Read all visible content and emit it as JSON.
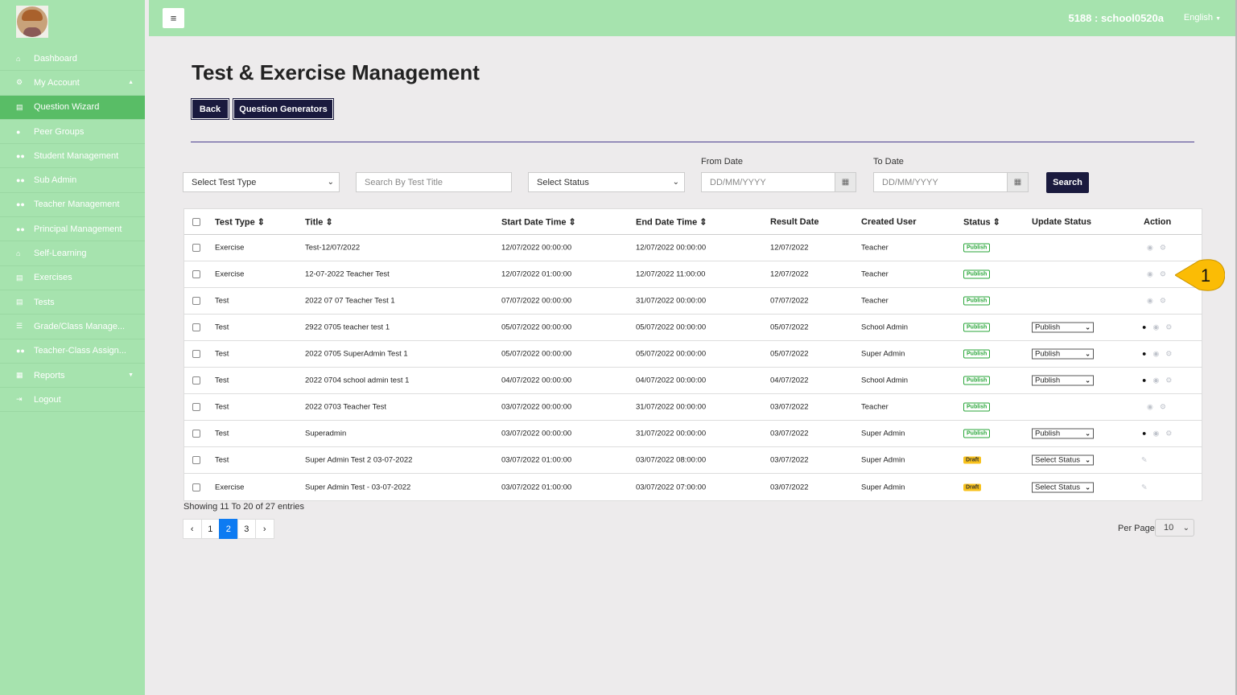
{
  "sidebar": {
    "items": [
      {
        "label": "Dashboard",
        "icon": "home-icon",
        "glyph": "⌂"
      },
      {
        "label": "My Account",
        "icon": "cogs-icon",
        "glyph": "⚙",
        "caret": "▲"
      },
      {
        "label": "Question Wizard",
        "icon": "book-icon",
        "glyph": "▤",
        "active": true
      },
      {
        "label": "Peer Groups",
        "icon": "user-icon",
        "glyph": "●"
      },
      {
        "label": "Student Management",
        "icon": "users-icon",
        "glyph": "●●"
      },
      {
        "label": "Sub Admin",
        "icon": "users-icon",
        "glyph": "●●"
      },
      {
        "label": "Teacher Management",
        "icon": "users-icon",
        "glyph": "●●"
      },
      {
        "label": "Principal Management",
        "icon": "users-icon",
        "glyph": "●●"
      },
      {
        "label": "Self-Learning",
        "icon": "home-icon",
        "glyph": "⌂"
      },
      {
        "label": "Exercises",
        "icon": "book-icon",
        "glyph": "▤"
      },
      {
        "label": "Tests",
        "icon": "book-icon",
        "glyph": "▤"
      },
      {
        "label": "Grade/Class Manage...",
        "icon": "list-icon",
        "glyph": "☰"
      },
      {
        "label": "Teacher-Class Assign...",
        "icon": "users-icon",
        "glyph": "●●"
      },
      {
        "label": "Reports",
        "icon": "table-icon",
        "glyph": "▦",
        "caret": "▼"
      },
      {
        "label": "Logout",
        "icon": "logout-icon",
        "glyph": "⇥"
      }
    ]
  },
  "topbar": {
    "user": "5188 : school0520a",
    "language": "English"
  },
  "page": {
    "title": "Test & Exercise Management",
    "back": "Back",
    "generators": "Question Generators"
  },
  "filters": {
    "test_type": "Select Test Type",
    "search_placeholder": "Search By Test Title",
    "status": "Select Status",
    "from_label": "From Date",
    "to_label": "To Date",
    "from_placeholder": "DD/MM/YYYY",
    "to_placeholder": "DD/MM/YYYY",
    "search_button": "Search"
  },
  "table": {
    "headers": [
      "Test Type ⇕",
      "Title ⇕",
      "Start Date Time ⇕",
      "End Date Time ⇕",
      "Result Date",
      "Created User",
      "Status ⇕",
      "Update Status",
      "Action"
    ],
    "rows": [
      {
        "type": "Exercise",
        "title": "Test-12/07/2022",
        "start": "12/07/2022 00:00:00",
        "end": "12/07/2022 00:00:00",
        "result": "12/07/2022",
        "user": "Teacher",
        "status": "Publish",
        "update": "",
        "actions": "view"
      },
      {
        "type": "Exercise",
        "title": "12-07-2022 Teacher Test",
        "start": "12/07/2022 01:00:00",
        "end": "12/07/2022 11:00:00",
        "result": "12/07/2022",
        "user": "Teacher",
        "status": "Publish",
        "update": "",
        "actions": "view"
      },
      {
        "type": "Test",
        "title": "2022 07 07 Teacher Test 1",
        "start": "07/07/2022 00:00:00",
        "end": "31/07/2022 00:00:00",
        "result": "07/07/2022",
        "user": "Teacher",
        "status": "Publish",
        "update": "",
        "actions": "view"
      },
      {
        "type": "Test",
        "title": "2922 0705 teacher test 1",
        "start": "05/07/2022 00:00:00",
        "end": "05/07/2022 00:00:00",
        "result": "05/07/2022",
        "user": "School Admin",
        "status": "Publish",
        "update": "Publish",
        "actions": "assign"
      },
      {
        "type": "Test",
        "title": "2022 0705 SuperAdmin Test 1",
        "start": "05/07/2022 00:00:00",
        "end": "05/07/2022 00:00:00",
        "result": "05/07/2022",
        "user": "Super Admin",
        "status": "Publish",
        "update": "Publish",
        "actions": "assign"
      },
      {
        "type": "Test",
        "title": "2022 0704 school admin test 1",
        "start": "04/07/2022 00:00:00",
        "end": "04/07/2022 00:00:00",
        "result": "04/07/2022",
        "user": "School Admin",
        "status": "Publish",
        "update": "Publish",
        "actions": "assign"
      },
      {
        "type": "Test",
        "title": "2022 0703 Teacher Test",
        "start": "03/07/2022 00:00:00",
        "end": "31/07/2022 00:00:00",
        "result": "03/07/2022",
        "user": "Teacher",
        "status": "Publish",
        "update": "",
        "actions": "view"
      },
      {
        "type": "Test",
        "title": "Superadmin",
        "start": "03/07/2022 00:00:00",
        "end": "31/07/2022 00:00:00",
        "result": "03/07/2022",
        "user": "Super Admin",
        "status": "Publish",
        "update": "Publish",
        "actions": "assign"
      },
      {
        "type": "Test",
        "title": "Super Admin Test 2 03-07-2022",
        "start": "03/07/2022 01:00:00",
        "end": "03/07/2022 08:00:00",
        "result": "03/07/2022",
        "user": "Super Admin",
        "status": "Draft",
        "update": "Select Status",
        "actions": "edit"
      },
      {
        "type": "Exercise",
        "title": "Super Admin Test - 03-07-2022",
        "start": "03/07/2022 01:00:00",
        "end": "03/07/2022 07:00:00",
        "result": "03/07/2022",
        "user": "Super Admin",
        "status": "Draft",
        "update": "Select Status",
        "actions": "edit"
      }
    ]
  },
  "footer": {
    "info": "Showing 11 To 20 of 27 entries",
    "pages": [
      "‹",
      "1",
      "2",
      "3",
      "›"
    ],
    "current_page": "2",
    "per_page_label": "Per Page",
    "per_page": "10"
  },
  "callout": {
    "label": "1",
    "color": "#fbbc05"
  },
  "colors": {
    "sidebar": "#a6e3ae",
    "active": "#59bd66",
    "primary": "#1a1a3e",
    "publish": "#2aa63a",
    "draft": "#f8c21c",
    "pager_active": "#0d7bf2"
  }
}
